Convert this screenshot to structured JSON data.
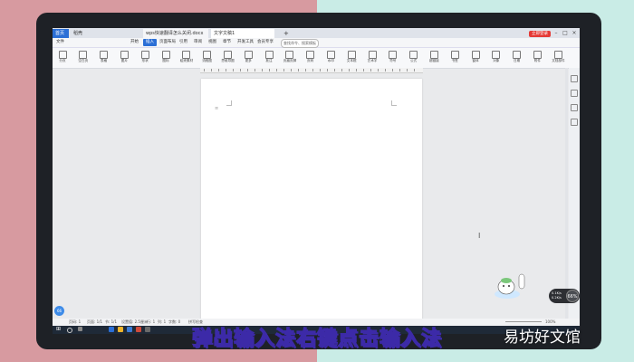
{
  "tabbar": {
    "home_tab": "首页",
    "tab_shell": "稻壳",
    "tab_doc1": "wps快速翻译怎么关闭.docx",
    "tab_doc2": "文字文稿1",
    "plus": "+",
    "login": "立即登录"
  },
  "ribbon": {
    "tabs": [
      "文件",
      "开始",
      "插入",
      "页面布局",
      "引用",
      "审阅",
      "视图",
      "章节",
      "开发工具",
      "会员专享"
    ],
    "active_index": 2,
    "search_placeholder": "查找命令、搜索模板"
  },
  "toolbar": {
    "items": [
      "分页",
      "空白页",
      "表格",
      "图片",
      "形状",
      "图标",
      "稻壳素材",
      "流程图",
      "思维导图",
      "更多",
      "批注",
      "页眉页脚",
      "页码",
      "水印",
      "文本框",
      "艺术字",
      "符号",
      "公式",
      "超链接",
      "书签",
      "窗体",
      "对象",
      "日期",
      "附件",
      "文档部件"
    ]
  },
  "document": {
    "cursor_marker": "≡"
  },
  "statusbar": {
    "page": "页码: 1",
    "pages": "页面: 1/1",
    "section": "节: 1/1",
    "position": "设置值: 2.5厘米",
    "row": "行: 1",
    "col": "列: 1",
    "words": "字数: 0",
    "spell": "拼写检查",
    "zoom": "100%"
  },
  "floating": {
    "left_badge": "66",
    "speed": "66%",
    "speed_up": "0.1K/s",
    "speed_down": "0.2K/s"
  },
  "overlay": {
    "subtitle": "弹出输入法右键点击输入法",
    "watermark": "易坊好文馆"
  },
  "colors": {
    "accent": "#2b6fd6",
    "login": "#e53935",
    "background_left": "#d79aa0",
    "background_right": "#c9ece6",
    "subtitle_stroke": "#3c2aa8"
  }
}
